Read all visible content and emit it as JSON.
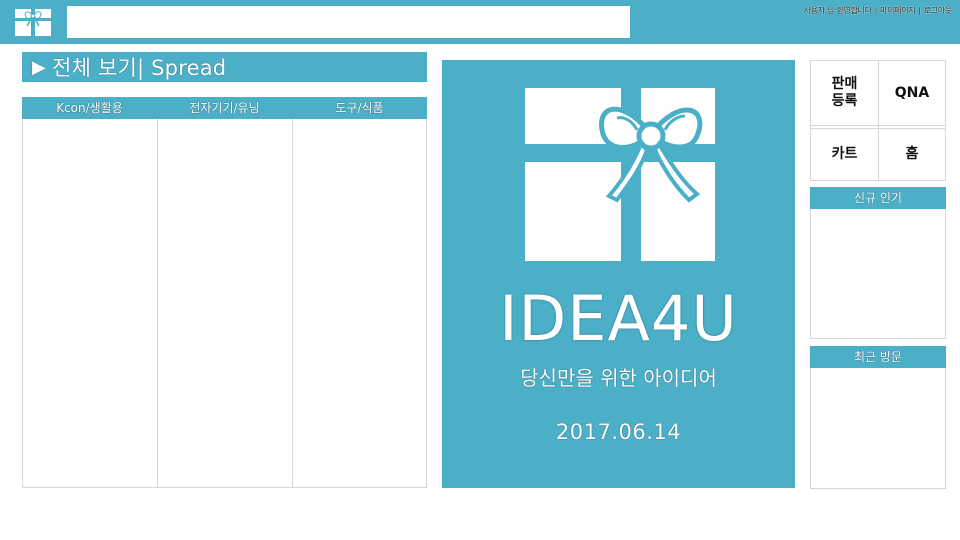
{
  "header": {
    "search_placeholder": "",
    "links": [
      "사용자 님 환영합니다",
      "마이페이지",
      "로그아웃"
    ]
  },
  "spread_bar": {
    "icon": "play-icon",
    "label": "전체 보기| Spread"
  },
  "categories": {
    "columns": [
      "Kcon/생활용",
      "전자기기/유닝",
      "도구/식품"
    ]
  },
  "hero": {
    "title": "IDEA4U",
    "subtitle": "당신만을 위한 아이디어",
    "date": "2017.06.14"
  },
  "menu": {
    "sell_label": "판매\n등록",
    "qna_label": "QNA",
    "cart_label": "카트",
    "home_label": "홈"
  },
  "panels": {
    "new_popular": "신규 인기",
    "recent_viewed": "최근 방문"
  },
  "colors": {
    "accent": "#4bafc8",
    "border": "#d6d6d6"
  }
}
